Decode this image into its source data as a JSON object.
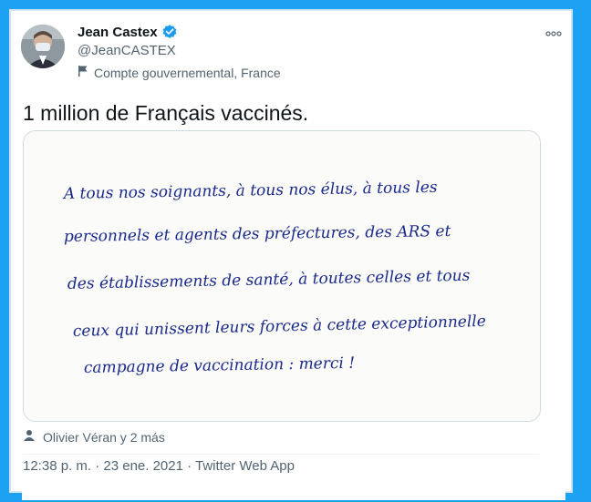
{
  "tweet": {
    "author_name": "Jean Castex",
    "author_handle": "@JeanCASTEX",
    "gov_label": "Compte gouvernemental, France",
    "text": "1 million de Français vaccinés.",
    "handwritten_note": [
      "A tous nos soignants, à tous nos élus, à tous les",
      "personnels et agents des préfectures, des ARS et",
      "des établissements de santé, à toutes celles et tous",
      "ceux qui unissent leurs forces à cette exceptionnelle",
      "campagne de vaccination : merci !"
    ],
    "tagged": "Olivier Véran y 2 más",
    "timestamp": "12:38 p. m. · 23 ene. 2021 · Twitter Web App"
  },
  "icons": {
    "verified": "verified-badge-icon",
    "flag": "flag-icon",
    "person": "person-icon",
    "more": "more-icon"
  },
  "colors": {
    "accent": "#1da1f2",
    "ink": "#1a2a8a"
  }
}
